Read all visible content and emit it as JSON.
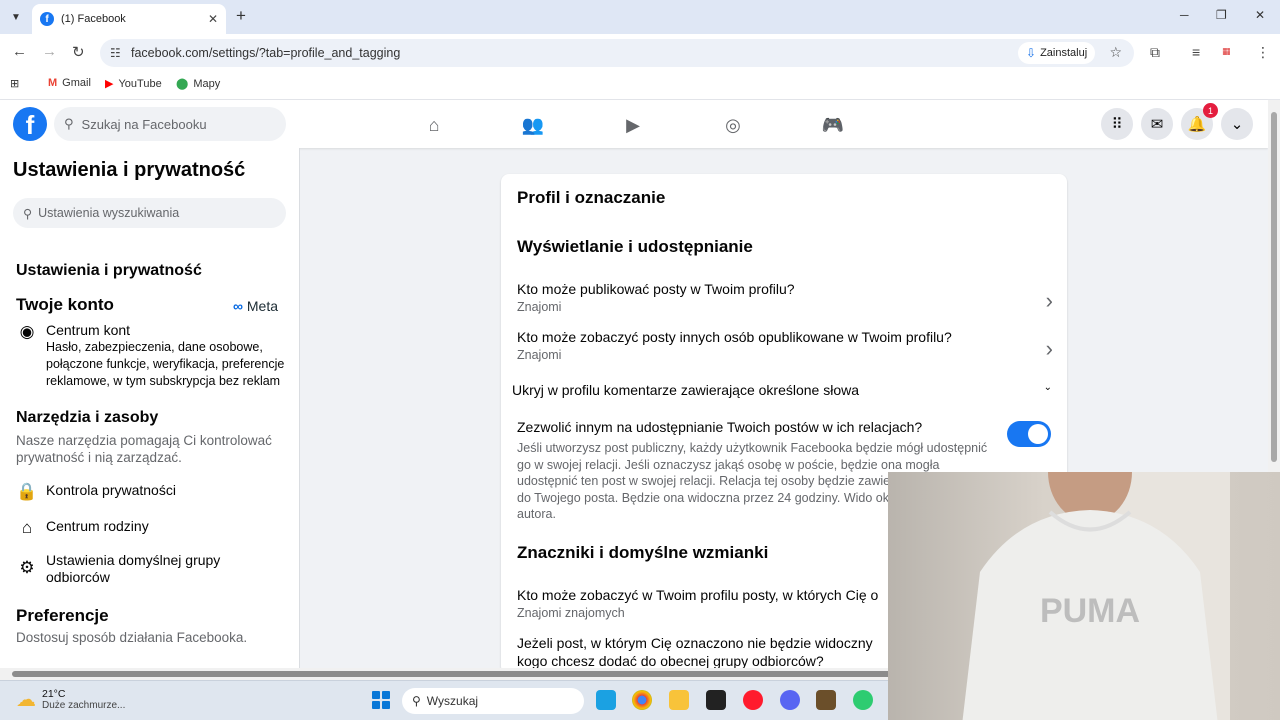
{
  "browser": {
    "tab_title": "(1) Facebook",
    "url": "facebook.com/settings/?tab=profile_and_tagging",
    "install_label": "Zainstaluj",
    "bookmarks": [
      {
        "icon": "gmail-icon",
        "label": "Gmail"
      },
      {
        "icon": "youtube-icon",
        "label": "YouTube"
      },
      {
        "icon": "maps-icon",
        "label": "Mapy"
      }
    ]
  },
  "fb": {
    "search_placeholder": "Szukaj na Facebooku",
    "notification_count": "1",
    "brand_color": "#1877f2"
  },
  "sidebar": {
    "title": "Ustawienia i prywatność",
    "search_placeholder": "Ustawienia wyszukiwania",
    "section_settings": "Ustawienia i prywatność",
    "section_account": "Twoje konto",
    "meta_label": "Meta",
    "accounts_center": {
      "label": "Centrum kont",
      "desc": "Hasło, zabezpieczenia, dane osobowe, połączone funkcje, weryfikacja, preferencje reklamowe, w tym subskrypcja bez reklam"
    },
    "tools_title": "Narzędzia i zasoby",
    "tools_desc": "Nasze narzędzia pomagają Ci kontrolować prywatność i nią zarządzać.",
    "tools_items": [
      "Kontrola prywatności",
      "Centrum rodziny",
      "Ustawienia domyślnej grupy odbiorców"
    ],
    "prefs_title": "Preferencje",
    "prefs_desc": "Dostosuj sposób działania Facebooka."
  },
  "main": {
    "title": "Profil i oznaczanie",
    "section1": "Wyświetlanie i udostępnianie",
    "rows1": [
      {
        "question": "Kto może publikować posty w Twoim profilu?",
        "value": "Znajomi"
      },
      {
        "question": "Kto może zobaczyć posty innych osób opublikowane w Twoim profilu?",
        "value": "Znajomi"
      }
    ],
    "hide_comments": "Ukryj w profilu komentarze zawierające określone słowa",
    "share_question": "Zezwolić innym na udostępnianie Twoich postów w ich relacjach?",
    "share_desc": "Jeśli utworzysz post publiczny, każdy użytkownik Facebooka będzie mógł udostępnić go w swojej relacji. Jeśli oznaczysz jakąś osobę w poście, będzie ona mogła udostępnić ten post w swojej relacji. Relacja tej osoby będzie zawierać Twoje im link do Twojego posta. Będzie ona widoczna przez 24 godziny. Wido określana przez jej autora.",
    "share_enabled": true,
    "section2": "Znaczniki i domyślne wzmianki",
    "rows2": [
      {
        "question": "Kto może zobaczyć w Twoim profilu posty, w których Cię o",
        "value": "Znajomi znajomych"
      },
      {
        "question": "Jeżeli post, w którym Cię oznaczono nie będzie widoczny kogo chcesz dodać do obecnej grupy odbiorców?",
        "value": ""
      }
    ]
  },
  "taskbar": {
    "temp": "21°C",
    "weather": "Duże zachmurze...",
    "search_placeholder": "Wyszukaj"
  },
  "webcam": {
    "shirt_text": "PUMA"
  }
}
